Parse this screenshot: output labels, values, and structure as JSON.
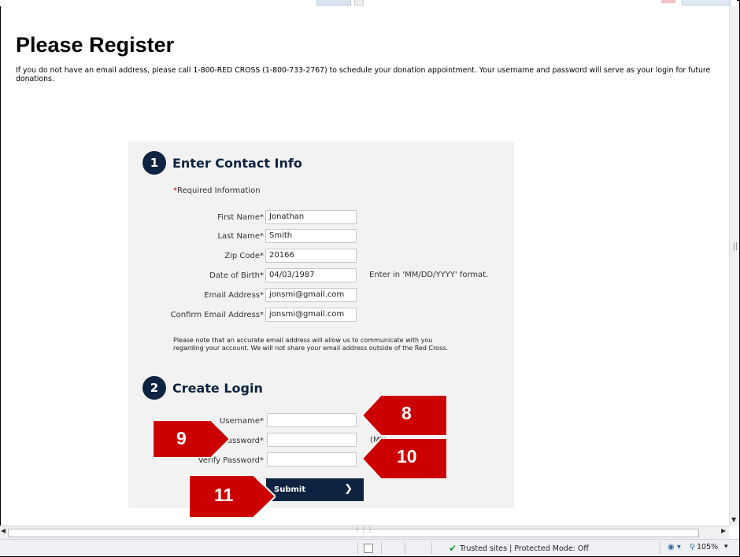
{
  "page": {
    "title": "Please Register",
    "intro": "If you do not have an email address, please call 1-800-RED CROSS (1-800-733-2767) to schedule your donation appointment. Your username and password will serve as your login for future donations."
  },
  "step1": {
    "number": "1",
    "title": "Enter Contact Info",
    "required_note": "Required Information",
    "fields": {
      "first_name": {
        "label": "First Name",
        "value": "Jonathan"
      },
      "last_name": {
        "label": "Last Name",
        "value": "Smith"
      },
      "zip": {
        "label": "Zip Code",
        "value": "20166"
      },
      "dob": {
        "label": "Date of Birth",
        "value": "04/03/1987",
        "hint": "Enter in 'MM/DD/YYYY' format."
      },
      "email": {
        "label": "Email Address",
        "value": "jonsmi@gmail.com"
      },
      "confirm_email": {
        "label": "Confirm Email Address",
        "value": "jonsmi@gmail.com"
      }
    },
    "note": "Please note that an accurate email address will allow us to communicate with you regarding your account. We will not share your email address outside of the Red Cross."
  },
  "step2": {
    "number": "2",
    "title": "Create Login",
    "fields": {
      "username": {
        "label": "Username",
        "value": ""
      },
      "password": {
        "label": "assword",
        "value": "",
        "hint": "(Min."
      },
      "verify_password": {
        "label": "Verify Password",
        "value": ""
      }
    },
    "submit_label": "Submit",
    "submit_icon": "chevron-right-icon"
  },
  "callouts": {
    "c8": "8",
    "c9": "9",
    "c10": "10",
    "c11": "11"
  },
  "statusbar": {
    "zone_text": "Trusted sites | Protected Mode: Off",
    "zoom": "105%"
  },
  "colors": {
    "navy": "#0e2341",
    "required_star": "#cc0000",
    "callout_red": "#cc0000",
    "panel_bg": "#f2f2f2"
  }
}
